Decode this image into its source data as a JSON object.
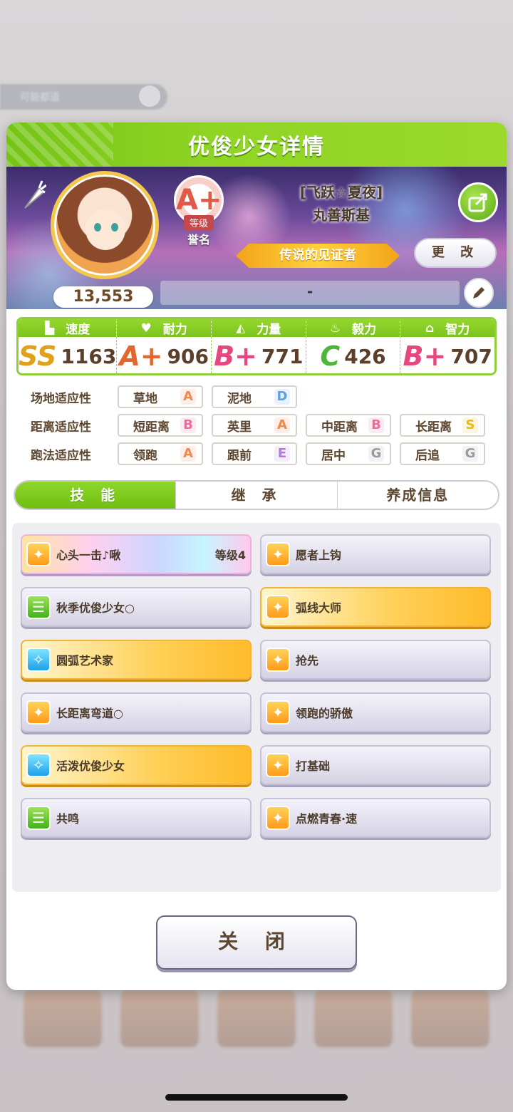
{
  "background": {
    "bar_text": "可能都道"
  },
  "dialog": {
    "title": "优俊少女详情",
    "score": "13,553",
    "rank": {
      "grade": "A+",
      "level_label": "等级",
      "name": "誉名"
    },
    "character": {
      "epithet": "[飞跃☆夏夜]",
      "name": "丸善斯基"
    },
    "honor_title": "传说的见证者",
    "change_button": "更 改",
    "motto": "-",
    "stats": [
      {
        "label": "速度",
        "icon": "shoe-icon",
        "grade": "SS",
        "value": "1163",
        "color": "#e0a11d"
      },
      {
        "label": "耐力",
        "icon": "heart-icon",
        "grade": "A+",
        "value": "906",
        "color": "#e2662d"
      },
      {
        "label": "力量",
        "icon": "muscle-icon",
        "grade": "B+",
        "value": "771",
        "color": "#e7477e"
      },
      {
        "label": "毅力",
        "icon": "flame-icon",
        "grade": "C",
        "value": "426",
        "color": "#4cb63a"
      },
      {
        "label": "智力",
        "icon": "graduation-cap-icon",
        "grade": "B+",
        "value": "707",
        "color": "#e7477e"
      }
    ],
    "aptitude": {
      "track": {
        "label": "场地适应性",
        "items": [
          {
            "name": "草地",
            "grade": "A"
          },
          {
            "name": "泥地",
            "grade": "D"
          }
        ]
      },
      "distance": {
        "label": "距离适应性",
        "items": [
          {
            "name": "短距离",
            "grade": "B"
          },
          {
            "name": "英里",
            "grade": "A"
          },
          {
            "name": "中距离",
            "grade": "B"
          },
          {
            "name": "长距离",
            "grade": "S"
          }
        ]
      },
      "style": {
        "label": "跑法适应性",
        "items": [
          {
            "name": "领跑",
            "grade": "A"
          },
          {
            "name": "跟前",
            "grade": "E"
          },
          {
            "name": "居中",
            "grade": "G"
          },
          {
            "name": "后追",
            "grade": "G"
          }
        ]
      }
    },
    "tabs": [
      "技 能",
      "继 承",
      "养成信息"
    ],
    "skills": [
      {
        "name": "心头一击♪啾",
        "level": "等级4",
        "style": "rainbow",
        "icon": "speed"
      },
      {
        "name": "愿者上钩",
        "style": "normal",
        "icon": "speed"
      },
      {
        "name": "秋季优俊少女○",
        "style": "normal",
        "icon": "green"
      },
      {
        "name": "弧线大师",
        "style": "gold",
        "icon": "speed"
      },
      {
        "name": "圆弧艺术家",
        "style": "gold",
        "icon": "blue"
      },
      {
        "name": "抢先",
        "style": "normal",
        "icon": "speed"
      },
      {
        "name": "长距离弯道○",
        "style": "normal",
        "icon": "speed"
      },
      {
        "name": "领跑的骄傲",
        "style": "normal",
        "icon": "speed"
      },
      {
        "name": "活泼优俊少女",
        "style": "gold",
        "icon": "blue"
      },
      {
        "name": "打基础",
        "style": "normal",
        "icon": "speed"
      },
      {
        "name": "共鸣",
        "style": "normal",
        "icon": "green"
      },
      {
        "name": "点燃青春·速",
        "style": "normal",
        "icon": "speed"
      }
    ],
    "close_button": "关 闭"
  }
}
